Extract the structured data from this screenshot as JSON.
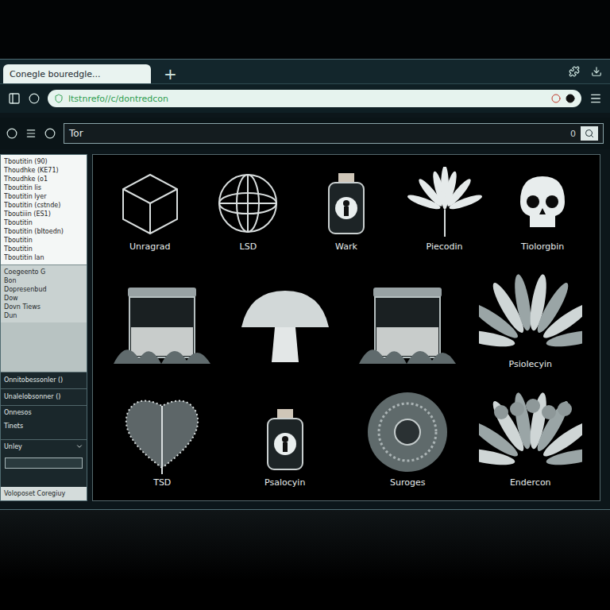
{
  "tab": {
    "title": "Conegle bouredgle...",
    "new_tab": "+"
  },
  "address": {
    "url": "ltstnrefo//c/dontredcon"
  },
  "search": {
    "value": "Tor",
    "count": "0"
  },
  "sidebar": {
    "list": [
      "Tboutitin (90)",
      "Thoudhke (KE71)",
      "Thoudhke (o1",
      "Tboutitin lis",
      "Tboutitin lyer",
      "Tboutitin (cstnde)",
      "Tboutiiin (ES1)",
      "Tboutitin",
      "Tboutitin (bltoedn)",
      "Tboutitin",
      "Tboutitin",
      "Tboutitin lan"
    ],
    "groups": [
      "Coegeento G",
      "Bon",
      "Dopresenbud",
      "Dow",
      "Dovn Tiews",
      "Dun"
    ],
    "options": [
      "Onnitobessonler ()",
      "Unalelobsonner ()"
    ],
    "links": [
      "Onnesos",
      "Tinets"
    ],
    "select": "Unley",
    "footer": "Voloposet Coregiuy"
  },
  "products": [
    [
      {
        "kind": "cube",
        "label": "Unragrad"
      },
      {
        "kind": "sphere",
        "label": "LSD"
      },
      {
        "kind": "bottle",
        "label": "Wark"
      },
      {
        "kind": "leaf",
        "label": "Piecodin"
      },
      {
        "kind": "skull",
        "label": "Tiolorgbin"
      }
    ],
    [
      {
        "kind": "jar",
        "label": null
      },
      {
        "kind": "mushroom",
        "label": null
      },
      {
        "kind": "jar",
        "label": null
      },
      {
        "kind": "plant",
        "label": "Psiolecyin"
      }
    ],
    [
      {
        "kind": "heart-leaf",
        "label": "TSD"
      },
      {
        "kind": "bottle",
        "label": "Psalocyin"
      },
      {
        "kind": "disc",
        "label": "Suroges"
      },
      {
        "kind": "bush",
        "label": "Endercon"
      }
    ]
  ]
}
